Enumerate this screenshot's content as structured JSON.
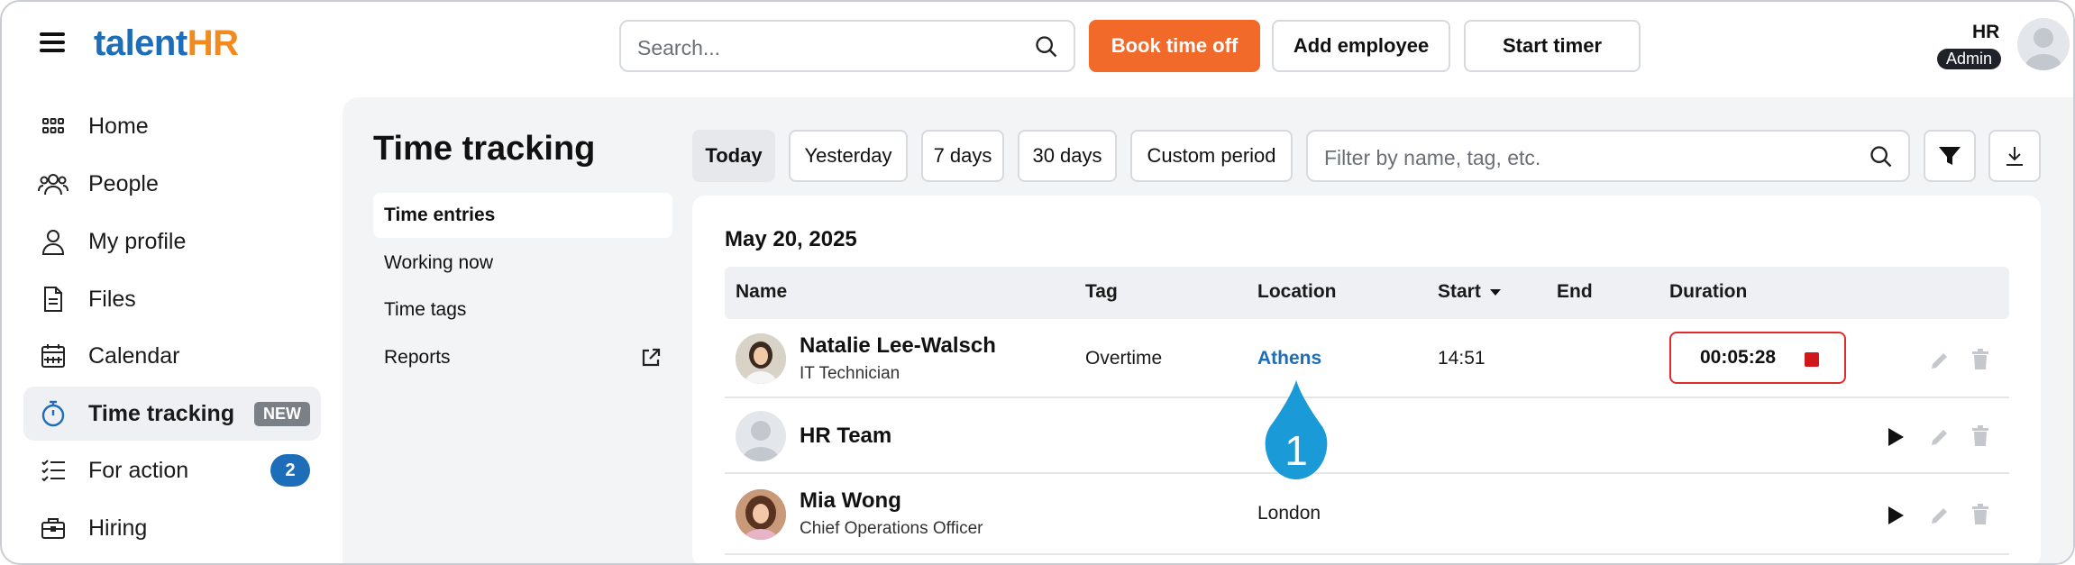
{
  "app": {
    "logo_part1": "talent",
    "logo_part2": "HR"
  },
  "header": {
    "search_placeholder": "Search...",
    "book_time_off": "Book time off",
    "add_employee": "Add employee",
    "start_timer": "Start timer",
    "user_initials": "HR",
    "user_role": "Admin"
  },
  "sidebar": {
    "items": [
      {
        "label": "Home",
        "icon": "grid-icon"
      },
      {
        "label": "People",
        "icon": "people-icon"
      },
      {
        "label": "My profile",
        "icon": "user-icon"
      },
      {
        "label": "Files",
        "icon": "file-icon"
      },
      {
        "label": "Calendar",
        "icon": "calendar-icon"
      },
      {
        "label": "Time tracking",
        "icon": "stopwatch-icon",
        "badge": "NEW",
        "active": true
      },
      {
        "label": "For action",
        "icon": "checklist-icon",
        "count": "2"
      },
      {
        "label": "Hiring",
        "icon": "briefcase-icon"
      }
    ]
  },
  "page": {
    "title": "Time tracking",
    "subnav": [
      "Time entries",
      "Working now",
      "Time tags",
      "Reports"
    ]
  },
  "filters": {
    "periods": [
      "Today",
      "Yesterday",
      "7 days",
      "30 days",
      "Custom period"
    ],
    "active_period": "Today",
    "filter_placeholder": "Filter by name, tag, etc."
  },
  "table": {
    "date": "May 20, 2025",
    "columns": [
      "Name",
      "Tag",
      "Location",
      "Start",
      "End",
      "Duration"
    ],
    "rows": [
      {
        "name": "Natalie Lee-Walsch",
        "role": "IT Technician",
        "tag": "Overtime",
        "location": "Athens",
        "start": "14:51",
        "end": "",
        "duration": "00:05:28"
      },
      {
        "name": "HR Team",
        "role": "",
        "tag": "",
        "location": "",
        "start": "",
        "end": "",
        "duration": ""
      },
      {
        "name": "Mia Wong",
        "role": "Chief Operations Officer",
        "tag": "",
        "location": "London",
        "start": "",
        "end": "",
        "duration": ""
      }
    ]
  },
  "annotation": {
    "callout_number": "1"
  },
  "colors": {
    "brand_blue": "#1e6db8",
    "brand_orange": "#f26a2a",
    "timer_red": "#e02b2b",
    "callout_blue": "#1a9ad6"
  }
}
